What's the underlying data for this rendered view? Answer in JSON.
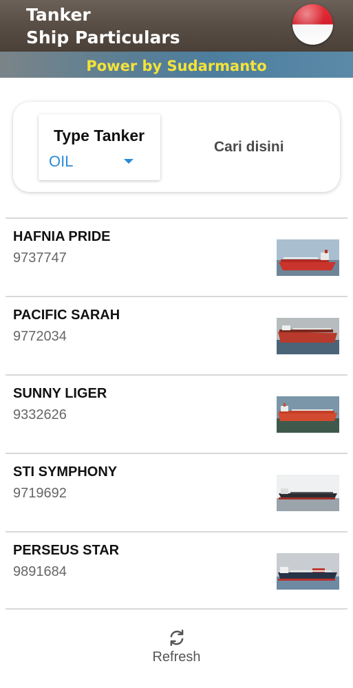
{
  "app": {
    "title_line1": "Tanker",
    "title_line2": "Ship Particulars",
    "flag_icon": "indonesia-flag-icon",
    "banner": "Power by Sudarmanto",
    "banner_color": "#f3e33a"
  },
  "filter": {
    "type_label": "Type Tanker",
    "type_value": "OIL",
    "search_hint": "Cari disini",
    "accent": "#2a8ad6"
  },
  "ships": [
    {
      "name": "HAFNIA PRIDE",
      "imo": "9737747"
    },
    {
      "name": "PACIFIC SARAH",
      "imo": "9772034"
    },
    {
      "name": "SUNNY LIGER",
      "imo": "9332626"
    },
    {
      "name": "STI SYMPHONY",
      "imo": "9719692"
    },
    {
      "name": "PERSEUS STAR",
      "imo": "9891684"
    }
  ],
  "footer": {
    "refresh_label": "Refresh",
    "refresh_icon": "refresh-icon"
  }
}
